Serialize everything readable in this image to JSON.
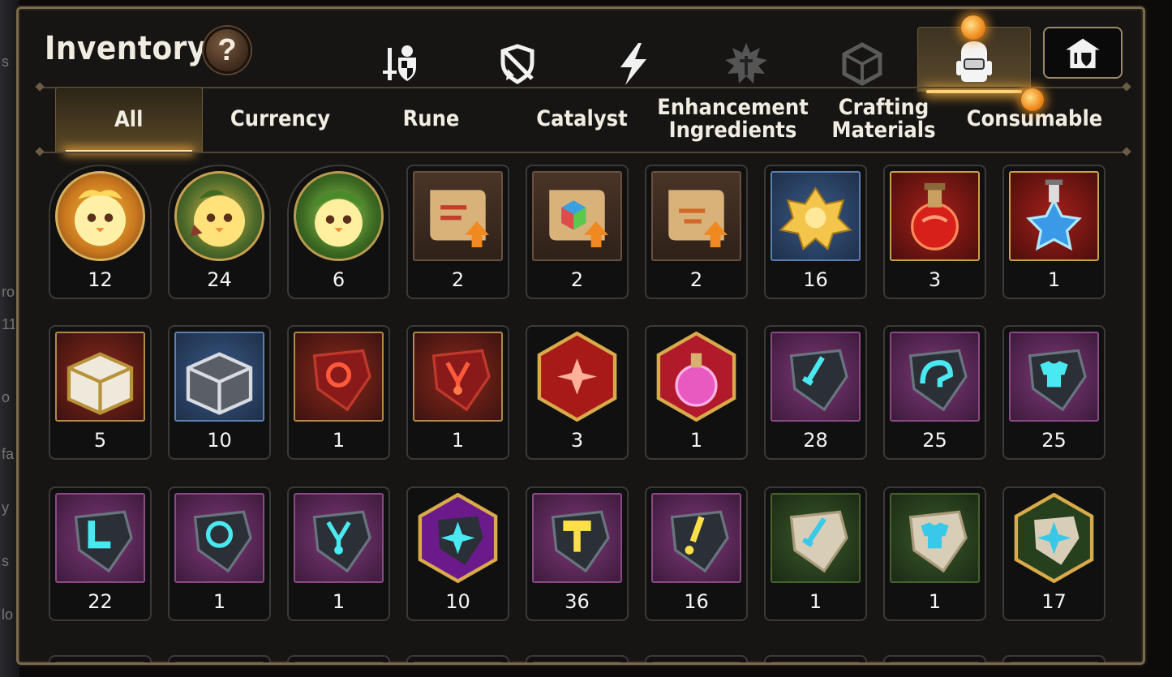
{
  "header": {
    "title": "Inventory",
    "help_label": "?"
  },
  "top_tabs": [
    {
      "name": "equipment-icon"
    },
    {
      "name": "artifact-icon"
    },
    {
      "name": "lightning-icon"
    },
    {
      "name": "splash-icon"
    },
    {
      "name": "cube-icon"
    },
    {
      "name": "backpack-icon",
      "active": true
    },
    {
      "name": "storage-icon"
    }
  ],
  "categories": {
    "all": "All",
    "currency": "Currency",
    "rune": "Rune",
    "catalyst": "Catalyst",
    "enhancement_l1": "Enhancement",
    "enhancement_l2": "Ingredients",
    "crafting_l1": "Crafting",
    "crafting_l2": "Materials",
    "consumable": "Consumable"
  },
  "items": [
    {
      "name": "phantasma-currency-item",
      "qty": "12"
    },
    {
      "name": "phantasma-leaf-currency-item",
      "qty": "24"
    },
    {
      "name": "phantasma-laurel-currency-item",
      "qty": "6"
    },
    {
      "name": "scroll-upgrade-item",
      "qty": "2"
    },
    {
      "name": "scroll-rainbow-upgrade-item",
      "qty": "2"
    },
    {
      "name": "scroll-upgrade-item-2",
      "qty": "2"
    },
    {
      "name": "gold-crystal-item",
      "qty": "16"
    },
    {
      "name": "red-potion-item",
      "qty": "3"
    },
    {
      "name": "star-potion-item",
      "qty": "1"
    },
    {
      "name": "gold-chest-item",
      "qty": "5"
    },
    {
      "name": "silver-chest-item",
      "qty": "10"
    },
    {
      "name": "red-ring-rune-item",
      "qty": "1"
    },
    {
      "name": "red-necklace-rune-item",
      "qty": "1"
    },
    {
      "name": "red-star-rune-item",
      "qty": "3"
    },
    {
      "name": "pink-flask-item",
      "qty": "1"
    },
    {
      "name": "blue-sword-rune-item",
      "qty": "28"
    },
    {
      "name": "blue-helm-rune-item",
      "qty": "25"
    },
    {
      "name": "blue-armor-rune-item",
      "qty": "25"
    },
    {
      "name": "blue-boots-rune-item",
      "qty": "22"
    },
    {
      "name": "blue-ring-rune-item",
      "qty": "1"
    },
    {
      "name": "blue-necklace-rune-item",
      "qty": "1"
    },
    {
      "name": "purple-star-rune-item",
      "qty": "10"
    },
    {
      "name": "gold-hammer-rune-item",
      "qty": "36"
    },
    {
      "name": "gold-exclaim-rune-item",
      "qty": "16"
    },
    {
      "name": "stone-sword-rune-item",
      "qty": "1"
    },
    {
      "name": "stone-armor-rune-item",
      "qty": "1"
    },
    {
      "name": "stone-star-rune-item",
      "qty": "17"
    }
  ]
}
